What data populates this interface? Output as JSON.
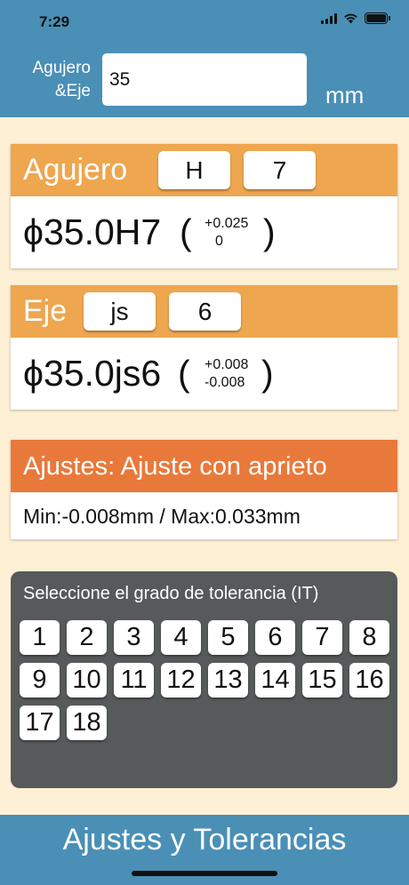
{
  "status": {
    "time": "7:29"
  },
  "header": {
    "size_label": "Agujero\n&Eje",
    "size_value": "35",
    "unit": "mm"
  },
  "hole": {
    "title": "Agujero",
    "letter": "H",
    "grade": "7",
    "designation": "ϕ35.0H7",
    "upper": "+0.025",
    "lower": "0"
  },
  "shaft": {
    "title": "Eje",
    "letter": "js",
    "grade": "6",
    "designation": "ϕ35.0js6",
    "upper": "+0.008",
    "lower": "-0.008"
  },
  "fit": {
    "title": "Ajustes: Ajuste con aprieto",
    "range": "Min:-0.008mm / Max:0.033mm"
  },
  "it_grades": {
    "title": "Seleccione el grado de tolerancia (IT)",
    "items": [
      "1",
      "2",
      "3",
      "4",
      "5",
      "6",
      "7",
      "8",
      "9",
      "10",
      "11",
      "12",
      "13",
      "14",
      "15",
      "16",
      "17",
      "18"
    ]
  },
  "footer": {
    "title": "Ajustes y Tolerancias"
  },
  "colors": {
    "header_blue": "#4a8fb5",
    "card_orange": "#eea64f",
    "fit_orange": "#e9793b",
    "panel_gray": "#575a5b",
    "background": "#fdf0d5"
  }
}
